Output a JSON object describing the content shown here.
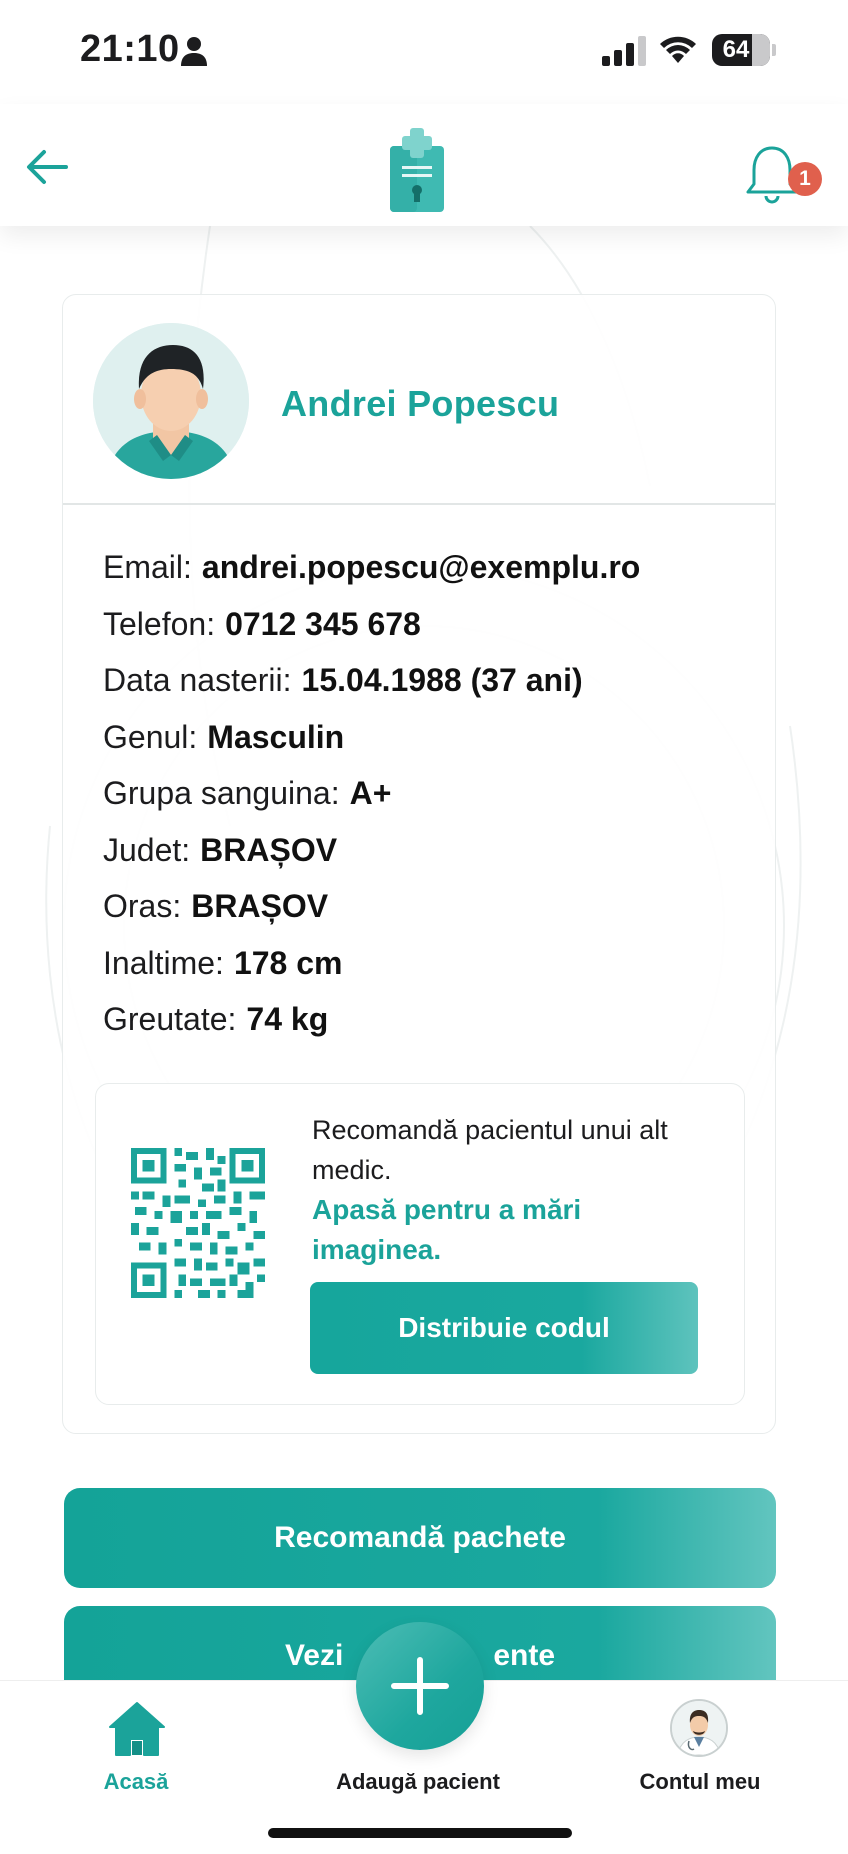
{
  "status_bar": {
    "time": "21:10",
    "battery": "64"
  },
  "header": {
    "notification_count": "1"
  },
  "profile": {
    "name": "Andrei Popescu",
    "details": [
      {
        "label": "Email:",
        "value": "andrei.popescu@exemplu.ro"
      },
      {
        "label": "Telefon:",
        "value": "0712 345 678"
      },
      {
        "label": "Data nasterii:",
        "value": "15.04.1988 (37 ani)"
      },
      {
        "label": "Genul:",
        "value": "Masculin"
      },
      {
        "label": "Grupa sanguina:",
        "value": "A+"
      },
      {
        "label": "Judet:",
        "value": "BRAȘOV"
      },
      {
        "label": "Oras:",
        "value": "BRAȘOV"
      },
      {
        "label": "Inaltime:",
        "value": "178 cm"
      },
      {
        "label": "Greutate:",
        "value": "74 kg"
      }
    ]
  },
  "qr": {
    "text": "Recomandă pacientul unui alt medic.",
    "link": "Apasă pentru a mări imaginea.",
    "share_label": "Distribuie codul"
  },
  "actions": {
    "packages_label": "Recomandă pachete",
    "second_label": "Vezi                  ente"
  },
  "nav": {
    "home_label": "Acasă",
    "add_label": "Adaugă pacient",
    "account_label": "Contul meu"
  },
  "colors": {
    "accent": "#1ba39a",
    "badge": "#e0604d"
  },
  "icons": [
    "person-icon",
    "signal-icon",
    "wifi-icon",
    "battery-icon",
    "back-arrow-icon",
    "clipboard-logo-icon",
    "bell-icon",
    "qr-code-icon",
    "home-icon",
    "plus-icon",
    "doctor-avatar-icon"
  ]
}
